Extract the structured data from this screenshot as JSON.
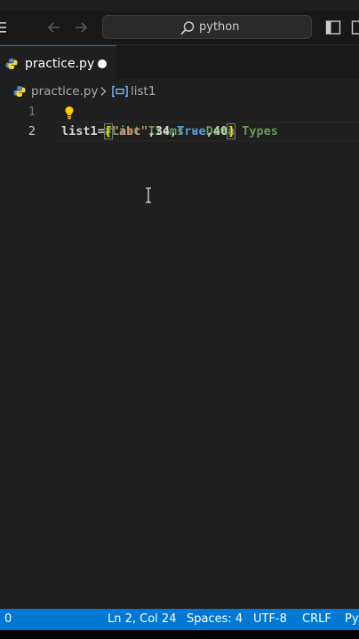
{
  "titlebar": {
    "search_text": "python"
  },
  "tab": {
    "label": "practice.py"
  },
  "breadcrumb": {
    "file": "practice.py",
    "symbol": "list1"
  },
  "editor": {
    "line_numbers": [
      "1",
      "2"
    ],
    "line1": {
      "comment": "#List Items - Data Types"
    },
    "line2": {
      "var": "list1",
      "eq": "=",
      "open": "[",
      "s1": "\"abc\"",
      "c1": ",",
      "n1": "34",
      "c2": ",",
      "kw": "True",
      "c3": ",",
      "n2": "40",
      "close": "]"
    }
  },
  "statusbar": {
    "left_count": "0",
    "position": "Ln 2, Col 24",
    "spaces": "Spaces: 4",
    "encoding": "UTF-8",
    "eol": "CRLF",
    "language": "Py"
  },
  "colors": {
    "accent": "#0078d4",
    "editor_bg": "#1f1f1f",
    "titlebar_bg": "#181818",
    "comment": "#6a9955",
    "string": "#ce9178",
    "number": "#b5cea8",
    "keyword": "#569cd6",
    "bracket": "#ffd700"
  },
  "icons": [
    "menu-icon",
    "back-arrow-icon",
    "forward-arrow-icon",
    "search-icon",
    "toggle-sidebar-icon",
    "layout-icon",
    "python-file-icon",
    "chevron-right-icon",
    "variable-symbol-icon",
    "lightbulb-icon"
  ]
}
